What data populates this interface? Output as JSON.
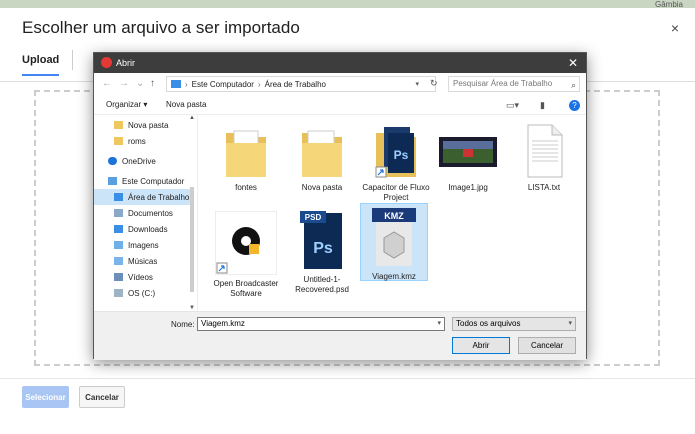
{
  "map": {
    "label": "Gâmbia"
  },
  "outer": {
    "title": "Escolher um arquivo a ser importado",
    "close": "×",
    "tab_upload": "Upload",
    "select_button": "Selecionar",
    "cancel_button": "Cancelar"
  },
  "dialog": {
    "title": "Abrir",
    "close": "✕",
    "address": {
      "root": "Este Computador",
      "sep": "›",
      "current": "Área de Trabalho"
    },
    "search_placeholder": "Pesquisar Área de Trabalho",
    "toolbar": {
      "organize": "Organizar ▾",
      "new_folder": "Nova pasta"
    },
    "nav_items": [
      {
        "label": "Nova pasta",
        "icon": "folder-icon"
      },
      {
        "label": "roms",
        "icon": "folder-icon"
      },
      {
        "label": "OneDrive",
        "icon": "cloud-icon"
      },
      {
        "label": "Este Computador",
        "icon": "computer-icon"
      },
      {
        "label": "Área de Trabalho",
        "icon": "desktop-icon"
      },
      {
        "label": "Documentos",
        "icon": "documents-icon"
      },
      {
        "label": "Downloads",
        "icon": "downloads-icon"
      },
      {
        "label": "Imagens",
        "icon": "images-icon"
      },
      {
        "label": "Músicas",
        "icon": "music-icon"
      },
      {
        "label": "Vídeos",
        "icon": "videos-icon"
      },
      {
        "label": "OS (C:)",
        "icon": "drive-icon"
      }
    ],
    "files": [
      {
        "label": "fontes",
        "type": "folder"
      },
      {
        "label": "Nova pasta",
        "type": "folder"
      },
      {
        "label": "Capacitor de Fluxo Project",
        "type": "shortcut-ps"
      },
      {
        "label": "Image1.jpg",
        "type": "image"
      },
      {
        "label": "LISTA.txt",
        "type": "text"
      },
      {
        "label": "Open Broadcaster Software",
        "type": "obs"
      },
      {
        "label": "Untitled-1-Recovered.psd",
        "type": "psd"
      },
      {
        "label": "Viagem.kmz",
        "type": "kmz"
      }
    ],
    "file_name_label": "Nome:",
    "file_name_value": "Viagem.kmz",
    "file_type": "Todos os arquivos",
    "open_button": "Abrir",
    "cancel_button": "Cancelar"
  }
}
